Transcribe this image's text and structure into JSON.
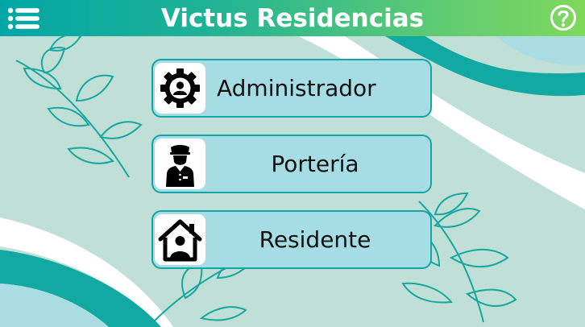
{
  "app": {
    "title": "Victus Residencias"
  },
  "icons": {
    "menu": "hamburger-menu-icon",
    "help": "question-circle-icon"
  },
  "roles": [
    {
      "label": "Administrador",
      "icon": "admin-gear-user-icon"
    },
    {
      "label": "Portería",
      "icon": "doorman-guard-icon"
    },
    {
      "label": "Residente",
      "icon": "house-person-icon"
    }
  ],
  "colors": {
    "header_start": "#00a6a6",
    "header_end": "#7fd95b",
    "background": "#c0dfd6",
    "teal_accent": "#12a9a2",
    "button_fill": "#a6dde4",
    "button_border": "#13a5a5"
  }
}
